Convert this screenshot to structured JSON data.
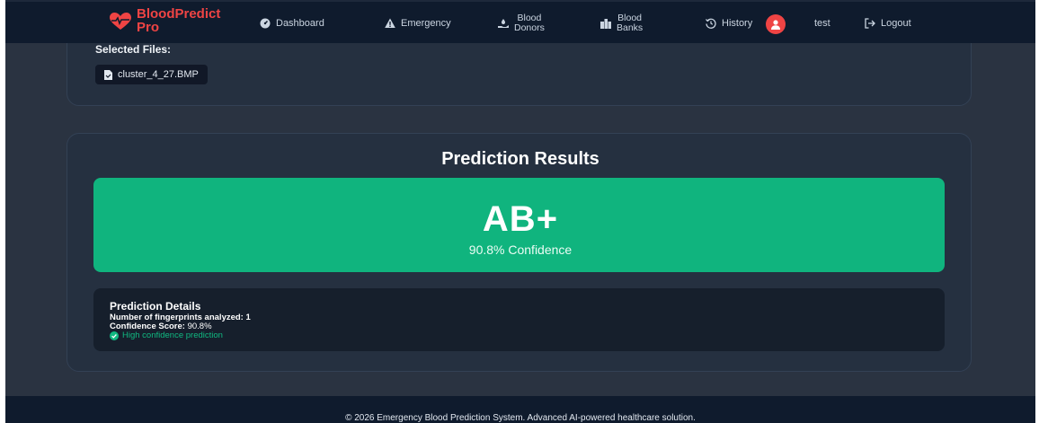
{
  "brand": {
    "line1": "BloodPredict",
    "line2": "Pro"
  },
  "nav": {
    "dashboard": "Dashboard",
    "emergency": "Emergency",
    "donors_1": "Blood",
    "donors_2": "Donors",
    "banks_1": "Blood",
    "banks_2": "Banks",
    "history": "History",
    "user": "test",
    "logout": "Logout"
  },
  "upload": {
    "selected_label": "Selected Files:",
    "file_name": "cluster_4_27.BMP"
  },
  "results": {
    "title": "Prediction Results",
    "blood_type": "AB+",
    "confidence_text": "90.8% Confidence",
    "details_title": "Prediction Details",
    "fingerprints_label": "Number of fingerprints analyzed:",
    "fingerprints_value": "1",
    "score_label": "Confidence Score:",
    "score_value": "90.8%",
    "high_conf": "High confidence prediction"
  },
  "footer": {
    "text": "© 2026 Emergency Blood Prediction System. Advanced AI-powered healthcare solution."
  },
  "colors": {
    "brand": "#ef4444",
    "result_green": "#10b47e",
    "success": "#10b981",
    "navbar": "#0f1b2d"
  }
}
